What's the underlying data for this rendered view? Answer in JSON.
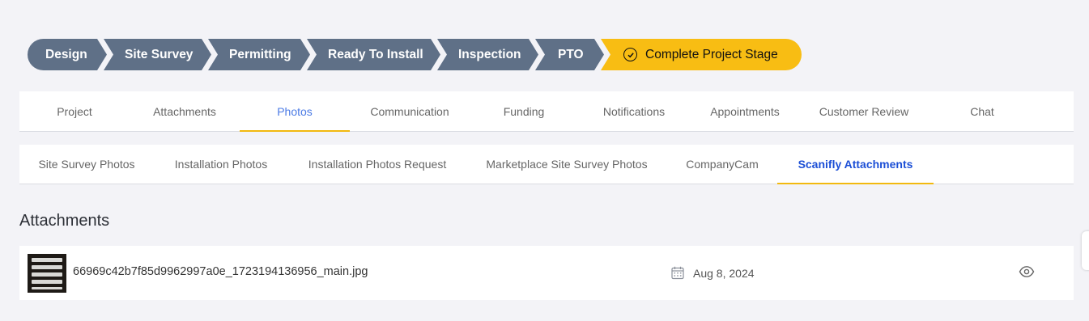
{
  "pipeline": {
    "stages": [
      "Design",
      "Site Survey",
      "Permitting",
      "Ready To Install",
      "Inspection",
      "PTO"
    ],
    "complete_label": "Complete Project Stage"
  },
  "main_tabs": [
    "Project",
    "Attachments",
    "Photos",
    "Communication",
    "Funding",
    "Notifications",
    "Appointments",
    "Customer Review",
    "Chat"
  ],
  "photo_tabs": [
    "Site Survey Photos",
    "Installation Photos",
    "Installation Photos Request",
    "Marketplace Site Survey Photos",
    "CompanyCam",
    "Scanifly Attachments"
  ],
  "attachments": {
    "title": "Attachments",
    "items": [
      {
        "filename": "66969c42b7f85d9962997a0e_1723194136956_main.jpg",
        "date": "Aug 8, 2024"
      }
    ]
  },
  "colors": {
    "stage": "#5f7087",
    "complete": "#f8bd13",
    "active_tab_underline": "#f2b90f"
  }
}
